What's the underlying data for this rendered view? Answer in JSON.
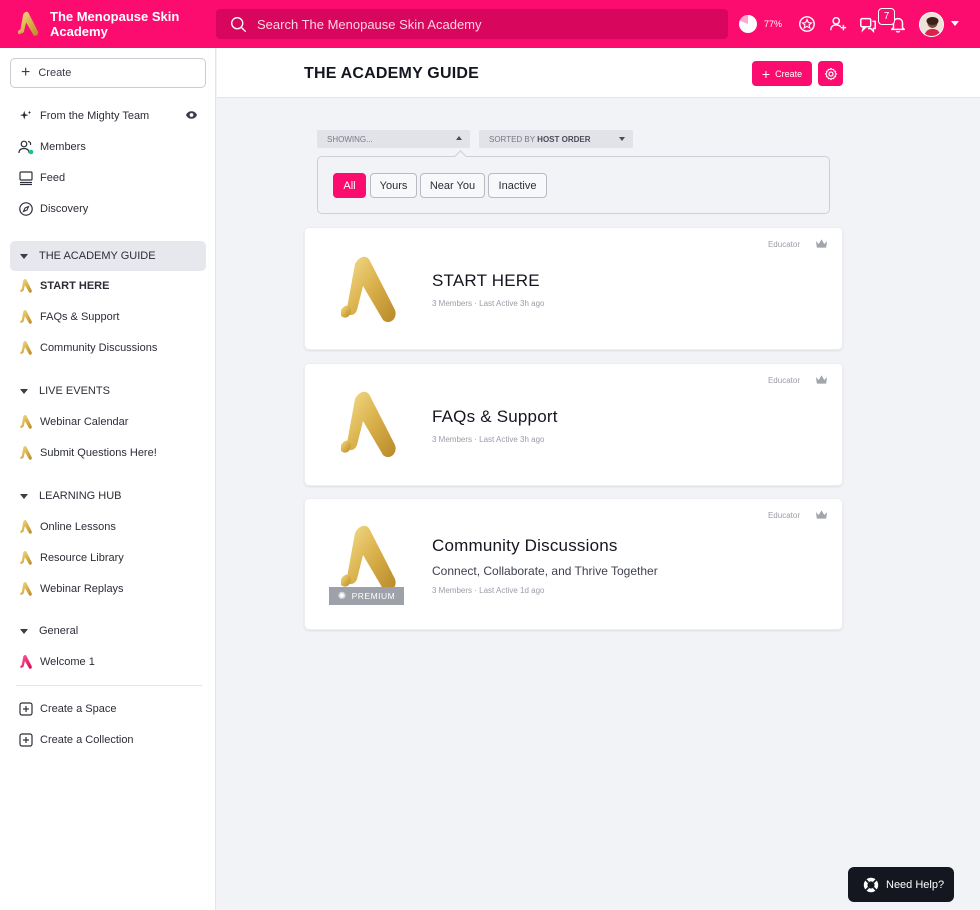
{
  "app": {
    "name": "The Menopause Skin Academy",
    "accent_color": "#fb0c6e"
  },
  "topbar": {
    "search_placeholder": "Search The Menopause Skin Academy",
    "progress_percent": 77,
    "progress_label": "77%",
    "notification_count": "7",
    "icons": [
      "pie-progress-icon",
      "badge-icon",
      "add-person-icon",
      "chat-icon",
      "bell-icon"
    ]
  },
  "sidebar": {
    "create_label": "Create",
    "top_items": [
      {
        "label": "From the Mighty Team",
        "icon": "sparkle-icon"
      },
      {
        "label": "Members",
        "icon": "members-icon"
      },
      {
        "label": "Feed",
        "icon": "feed-icon"
      },
      {
        "label": "Discovery",
        "icon": "compass-icon"
      }
    ],
    "sections": [
      {
        "label": "THE ACADEMY GUIDE",
        "items": [
          "START HERE",
          "FAQs & Support",
          "Community Discussions"
        ]
      },
      {
        "label": "LIVE EVENTS",
        "items": [
          "Webinar Calendar",
          "Submit Questions Here!"
        ]
      },
      {
        "label": "LEARNING HUB",
        "items": [
          "Online Lessons",
          "Resource Library",
          "Webinar Replays"
        ]
      },
      {
        "label": "General",
        "items": [
          "Welcome 1"
        ]
      }
    ],
    "footer_items": [
      {
        "label": "Create a Space"
      },
      {
        "label": "Create a Collection"
      }
    ]
  },
  "main": {
    "title": "THE ACADEMY GUIDE",
    "create_label": "Create",
    "showing_label": "SHOWING...",
    "sorted_prefix": "SORTED BY ",
    "sorted_value": "HOST ORDER",
    "filters": [
      "All",
      "Yours",
      "Near You",
      "Inactive"
    ],
    "active_filter": "All",
    "cards": [
      {
        "title": "START HERE",
        "subtitle": "",
        "meta": "3 Members · Last Active 3h ago",
        "role": "Educator",
        "premium": ""
      },
      {
        "title": "FAQs & Support",
        "subtitle": "",
        "meta": "3 Members · Last Active 3h ago",
        "role": "Educator",
        "premium": ""
      },
      {
        "title": "Community Discussions",
        "subtitle": "Connect, Collaborate, and Thrive Together",
        "meta": "3 Members · Last Active 1d ago",
        "role": "Educator",
        "premium": "PREMIUM"
      }
    ]
  },
  "help": {
    "label": "Need Help?"
  }
}
